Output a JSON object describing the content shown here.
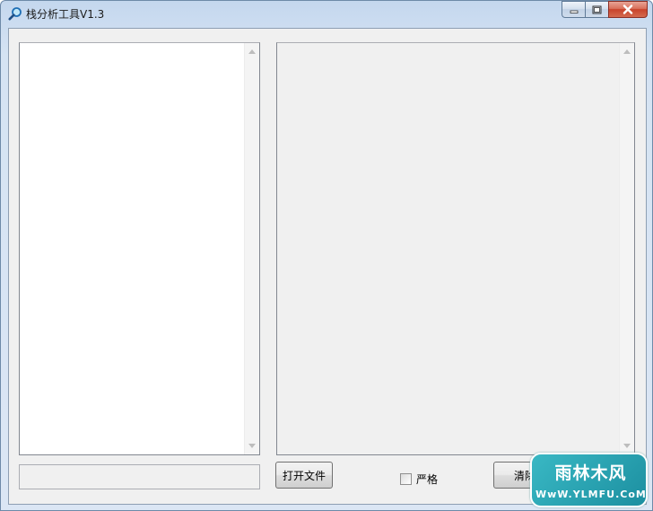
{
  "window": {
    "title": "栈分析工具V1.3",
    "icon": "magnifier-icon"
  },
  "controls": {
    "open_file_label": "打开文件",
    "strict_label": "严格",
    "strict_checked": false,
    "clear_label": "清除"
  },
  "watermark": {
    "main": "雨林木风",
    "sub": "WwW.YLMFU.CoM"
  },
  "colors": {
    "titlebar": "#c4d7ee",
    "close_button": "#c8432b",
    "client_bg": "#f0f0f0",
    "watermark": "#1c8fa0"
  }
}
